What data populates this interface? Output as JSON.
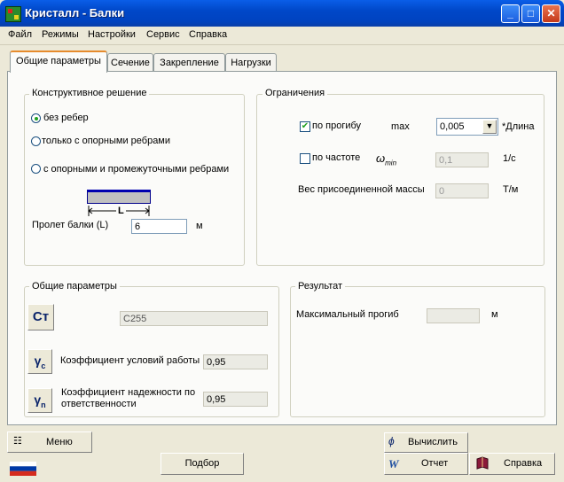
{
  "window": {
    "title": "Кристалл - Балки"
  },
  "menu": [
    "Файл",
    "Режимы",
    "Настройки",
    "Сервис",
    "Справка"
  ],
  "tabs": [
    "Общие параметры",
    "Сечение",
    "Закрепление",
    "Нагрузки"
  ],
  "design": {
    "title": "Конструктивное решение",
    "options": [
      "без ребер",
      "только с опорными ребрами",
      "с опорными и промежуточными ребрами"
    ],
    "selected_index": 0,
    "beam_label": "L",
    "span_label": "Пролет балки (L)",
    "span_value": "6",
    "span_unit": "м"
  },
  "limits": {
    "title": "Ограничения",
    "deflection_label": "по прогибу",
    "deflection_checked": true,
    "max_label": "max",
    "max_value": "0,005",
    "length_unit": "*Длина",
    "frequency_label": "по частоте",
    "frequency_checked": false,
    "omega_symbol": "ω",
    "omega_sub": "min",
    "frequency_value": "0,1",
    "frequency_unit": "1/с",
    "mass_label": "Вес присоединенной массы",
    "mass_value": "0",
    "mass_unit": "Т/м"
  },
  "common": {
    "title": "Общие параметры",
    "steel_button": "Ст",
    "steel_value": "С255",
    "gamma_c_symbol": "γ",
    "gamma_c_sub": "c",
    "gamma_c_label": "Коэффициент условий работы",
    "gamma_c_value": "0,95",
    "gamma_n_symbol": "γ",
    "gamma_n_sub": "n",
    "gamma_n_label": "Коэффициент надежности по ответственности",
    "gamma_n_value": "0,95"
  },
  "result": {
    "title": "Результат",
    "max_deflection_label": "Максимальный прогиб",
    "max_deflection_value": "",
    "unit": "м"
  },
  "bottom": {
    "menu_label": "Меню",
    "selection_label": "Подбор",
    "calculate_label": "Вычислить",
    "report_label": "Отчет",
    "help_label": "Справка"
  }
}
